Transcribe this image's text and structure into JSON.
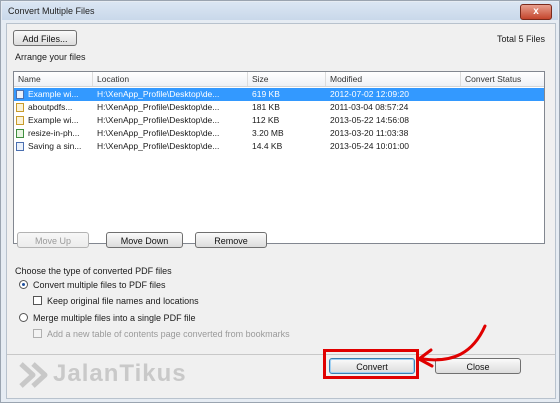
{
  "window": {
    "title": "Convert Multiple Files",
    "close_glyph": "x"
  },
  "toolbar": {
    "add_files_label": "Add Files...",
    "total_files": "Total 5 Files"
  },
  "list": {
    "caption": "Arrange your files",
    "columns": [
      "Name",
      "Location",
      "Size",
      "Modified",
      "Convert Status"
    ],
    "rows": [
      {
        "name": "Example wi...",
        "location": "H:\\XenApp_Profile\\Desktop\\de...",
        "size": "619 KB",
        "modified": "2012-07-02 12:09:20",
        "status": ""
      },
      {
        "name": "aboutpdfs...",
        "location": "H:\\XenApp_Profile\\Desktop\\de...",
        "size": "181 KB",
        "modified": "2011-03-04 08:57:24",
        "status": ""
      },
      {
        "name": "Example wi...",
        "location": "H:\\XenApp_Profile\\Desktop\\de...",
        "size": "112 KB",
        "modified": "2013-05-22 14:56:08",
        "status": ""
      },
      {
        "name": "resize-in-ph...",
        "location": "H:\\XenApp_Profile\\Desktop\\de...",
        "size": "3.20 MB",
        "modified": "2013-03-20 11:03:38",
        "status": ""
      },
      {
        "name": "Saving a sin...",
        "location": "H:\\XenApp_Profile\\Desktop\\de...",
        "size": "14.4 KB",
        "modified": "2013-05-24 10:01:00",
        "status": ""
      }
    ]
  },
  "actions": {
    "move_up": "Move Up",
    "move_down": "Move Down",
    "remove": "Remove"
  },
  "options": {
    "caption": "Choose the type of converted PDF files",
    "opt1": "Convert multiple files to PDF files",
    "opt1_sub": "Keep original file names and locations",
    "opt2": "Merge multiple files into a single PDF file",
    "opt2_sub": "Add a new table of contents page converted from bookmarks"
  },
  "footer": {
    "convert": "Convert",
    "close": "Close"
  },
  "watermark": {
    "text": "JalanTikus"
  },
  "colors": {
    "accent_red": "#e00000",
    "selection": "#3399ff"
  }
}
